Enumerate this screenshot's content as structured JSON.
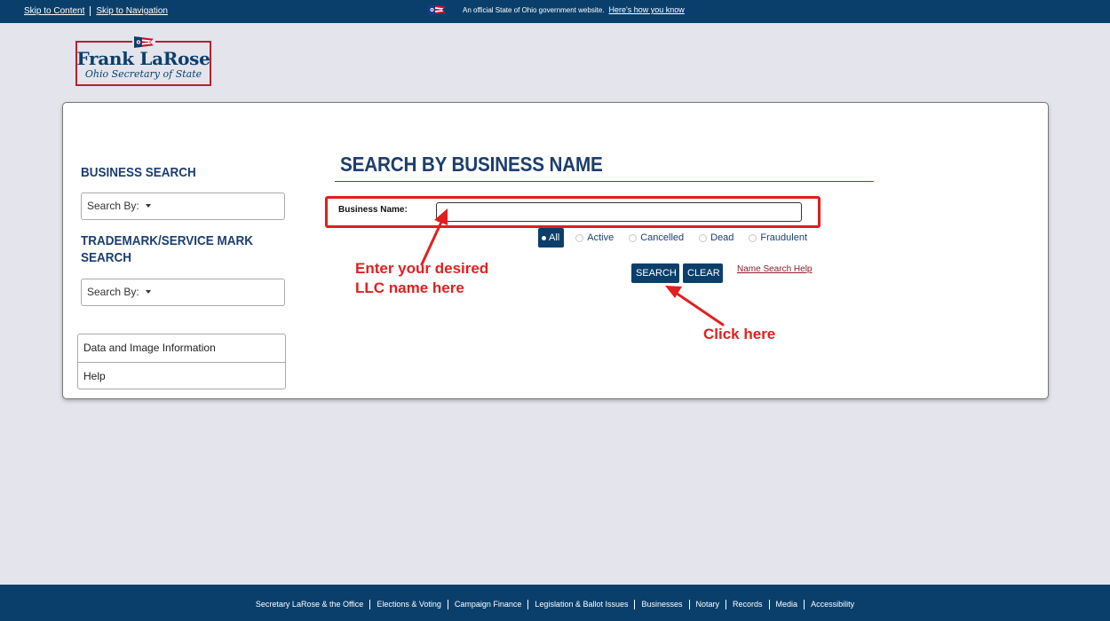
{
  "topbar": {
    "skip_content": "Skip to Content",
    "skip_navigation": "Skip to Navigation",
    "official_text": "An official State of Ohio government website.",
    "official_link": "Here's how you know",
    "flag_icon": "ohio-flag-icon"
  },
  "logo": {
    "name": "Frank LaRose",
    "subtitle": "Ohio Secretary of State"
  },
  "sidebar": {
    "business_heading": "BUSINESS SEARCH",
    "business_dropdown": "Search By:",
    "trademark_heading_line1": "TRADEMARK/SERVICE MARK",
    "trademark_heading_line2": "SEARCH",
    "trademark_dropdown": "Search By:",
    "links": [
      "Data and Image Information",
      "Help"
    ]
  },
  "main": {
    "title": "SEARCH BY BUSINESS NAME",
    "business_name_label": "Business Name:",
    "business_name_value": "",
    "status_options": [
      "All",
      "Active",
      "Cancelled",
      "Dead",
      "Fraudulent"
    ],
    "selected_status": "All",
    "search_button": "SEARCH",
    "clear_button": "CLEAR",
    "help_link": "Name Search Help"
  },
  "annotations": {
    "llc_line1": "Enter your desired",
    "llc_line2": "LLC name here",
    "click_here": "Click here"
  },
  "footer": {
    "links": [
      "Secretary LaRose & the Office",
      "Elections & Voting",
      "Campaign Finance",
      "Legislation & Ballot Issues",
      "Businesses",
      "Notary",
      "Records",
      "Media",
      "Accessibility"
    ]
  },
  "colors": {
    "navy": "#0b3f6b",
    "heading_blue": "#1d3e6e",
    "brand_red": "#b5202e",
    "annotation_red": "#e02020",
    "page_bg": "#e3e4ec"
  }
}
